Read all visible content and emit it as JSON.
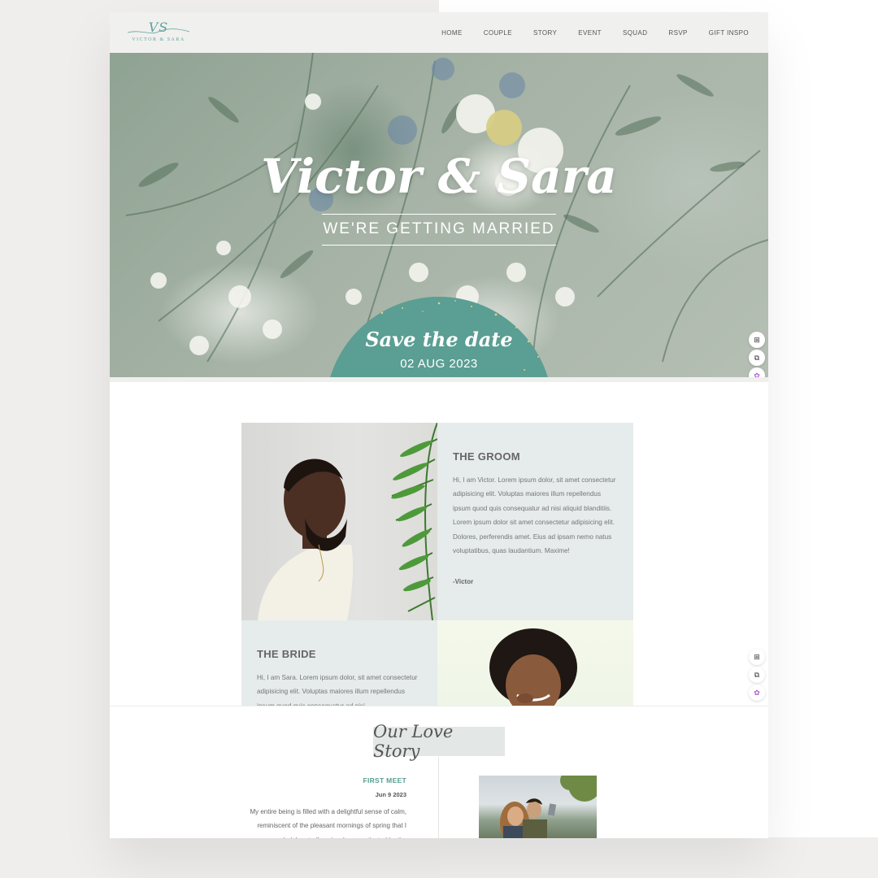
{
  "logo": {
    "monogram": "VS",
    "text": "VICTOR & SARA"
  },
  "nav": {
    "items": [
      "HOME",
      "COUPLE",
      "STORY",
      "EVENT",
      "SQUAD",
      "RSVP",
      "GIFT INSPO"
    ]
  },
  "hero": {
    "title": "Victor & Sara",
    "subtitle": "WE'RE GETTING MARRIED",
    "save_the_date": "Save the date",
    "date": "02 AUG 2023"
  },
  "tools": {
    "icons": [
      "translate-icon",
      "reader-icon",
      "brain-icon"
    ],
    "glyphs": [
      "⊞",
      "⧉",
      "✿"
    ]
  },
  "groom": {
    "heading": "THE GROOM",
    "text": "Hi, I am Victor. Lorem ipsum dolor, sit amet consectetur adipisicing elit. Voluptas maiores illum repellendus ipsum quod quis consequatur ad nisi aliquid blanditiis. Lorem ipsum dolor sit amet consectetur adipisicing elit. Dolores, perferendis amet. Eius ad ipsam nemo natus voluptatibus, quas laudantium. Maxime!",
    "signature": "-Victor"
  },
  "bride": {
    "heading": "THE BRIDE",
    "text": "Hi, I am Sara. Lorem ipsum dolor, sit amet consectetur adipisicing elit. Voluptas maiores illum repellendus ipsum quod quis consequatur ad nisi"
  },
  "story": {
    "title": "Our Love Story",
    "event_label": "FIRST MEET",
    "event_date": "Jun 9 2023",
    "event_text": "My entire being is filled with a delightful sense of calm, reminiscent of the pleasant mornings of spring that I wholeheartedly enjoy. I am captivated by the"
  },
  "colors": {
    "accent": "#5b9e93",
    "panel": "#e6ebeb",
    "nav_bg": "#f0f0ef"
  }
}
